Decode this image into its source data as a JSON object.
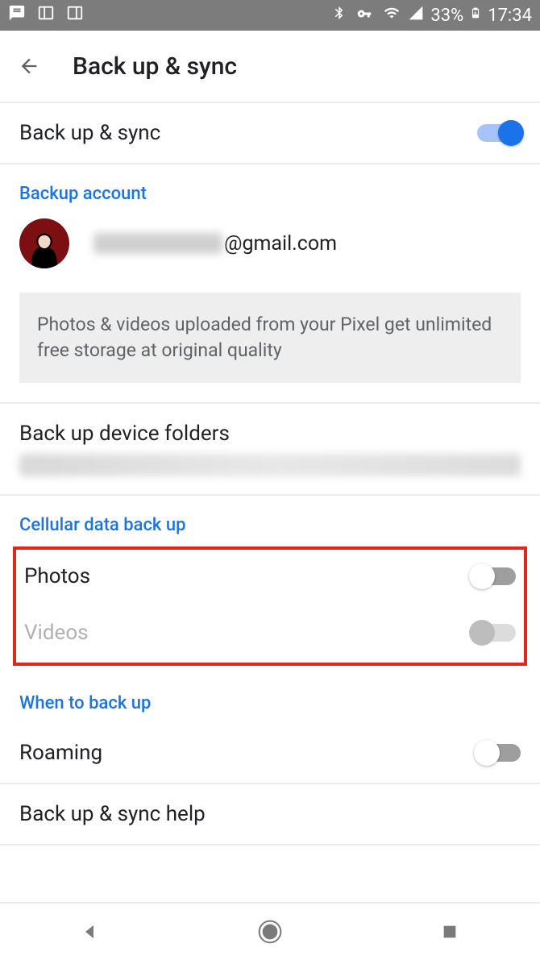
{
  "status": {
    "battery_pct": "33%",
    "time": "17:34"
  },
  "header": {
    "title": "Back up & sync"
  },
  "main_toggle": {
    "label": "Back up & sync",
    "on": true
  },
  "backup_account": {
    "section_label": "Backup account",
    "email_suffix": "@gmail.com"
  },
  "info_card": "Photos & videos uploaded from your Pixel get unlimited free storage at original quality",
  "device_folders": {
    "label": "Back up device folders"
  },
  "cellular": {
    "section_label": "Cellular data back up",
    "photos_label": "Photos",
    "photos_on": false,
    "videos_label": "Videos",
    "videos_on": false,
    "videos_disabled": true
  },
  "when": {
    "section_label": "When to back up",
    "roaming_label": "Roaming",
    "roaming_on": false
  },
  "help": {
    "label": "Back up & sync help"
  }
}
